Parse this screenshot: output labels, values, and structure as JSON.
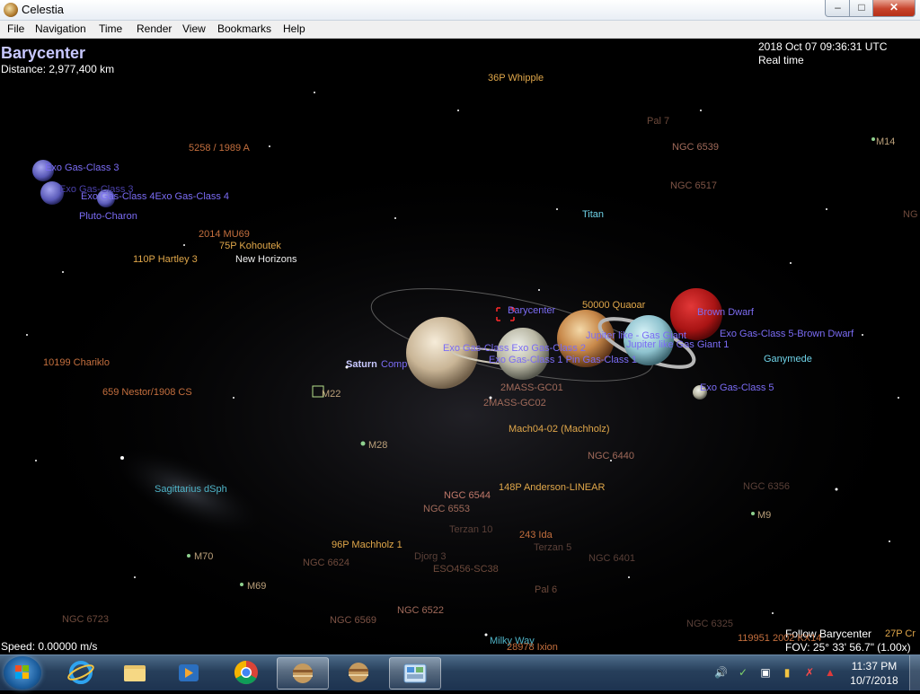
{
  "window": {
    "title": "Celestia",
    "min": "–",
    "max": "□",
    "close": "✕"
  },
  "menu": [
    "File",
    "Navigation",
    "Time",
    "Render",
    "View",
    "Bookmarks",
    "Help"
  ],
  "hud": {
    "target": "Barycenter",
    "distance": "Distance: 2,977,400 km",
    "datetime": "2018 Oct 07 09:36:31 UTC",
    "timemode": "Real time",
    "speed": "Speed: 0.00000 m/s",
    "follow": "Follow Barycenter",
    "fov": "FOV: 25° 33' 56.7\" (1.00x)"
  },
  "labels": {
    "whipple": "36P Whipple",
    "pal7": "Pal 7",
    "ngc6539": "NGC 6539",
    "m14": "M14",
    "ngc6517": "NGC 6517",
    "ng_edge": "NG",
    "titan": "Titan",
    "a5258": "5258 / 1989 A",
    "exo3a": "Exo Gas-Class 3",
    "exo3b": "Exo Gas-Class 3",
    "exo4group": "Exo Gas-Class 4Exo Gas-Class 4",
    "pluto": "Pluto-Charon",
    "mu69": "2014 MU69",
    "kohoutek": "75P Kohoutek",
    "hartley": "110P Hartley 3",
    "newhorizons": "New Horizons",
    "barycenter": "Barycenter",
    "quaoar": "50000 Quaoar",
    "browndwarf": "Brown Dwarf",
    "jupiterlike1": "Jupiter like - Gas Giant",
    "jupiterlike2": "Jupiter like Gas Giant 1",
    "exo5bd": "Exo Gas-Class 5-Brown Dwarf",
    "ganymede": "Ganymede",
    "exo5": "Exo Gas-Class 5",
    "exogroup": "Exo Gas-Class Exo Gas-Class 2",
    "exogroup2": "Exo Gas-Class 1 Pin Gas-Class 1",
    "chariklo": "10199 Chariklo",
    "nestor": "659 Nestor/1908 CS",
    "saturn": "Saturn",
    "comp": "Comp",
    "m22": "M22",
    "gc01": "2MASS-GC01",
    "gc02": "2MASS-GC02",
    "macholz_overlap": "Mach04-02 (Machholz)",
    "m28": "M28",
    "ngc6440": "NGC 6440",
    "sagdsph": "Sagittarius dSph",
    "anderson": "148P Anderson-LINEAR",
    "ngc6544": "NGC 6544",
    "ngc6553": "NGC 6553",
    "ngc6356": "NGC 6356",
    "m9": "M9",
    "terzan10": "Terzan 10",
    "ida": "243 Ida",
    "terzan5": "Terzan 5",
    "machholz1": "96P Machholz 1",
    "m70": "M70",
    "ngc6624": "NGC 6624",
    "djorg3": "Djorg 3",
    "eso456": "ESO456-SC38",
    "ngc6401": "NGC 6401",
    "m69": "M69",
    "pal6": "Pal 6",
    "ngc6723": "NGC 6723",
    "ngc6569": "NGC 6569",
    "ngc6522": "NGC 6522",
    "ngc6325": "NGC 6325",
    "milkyway": "Milky Way",
    "ixion": "28978 Ixion",
    "a119951": "119951 2002 KX14",
    "crommelin": "27P Cr"
  },
  "taskbar": {
    "time": "11:37 PM",
    "date": "10/7/2018"
  }
}
